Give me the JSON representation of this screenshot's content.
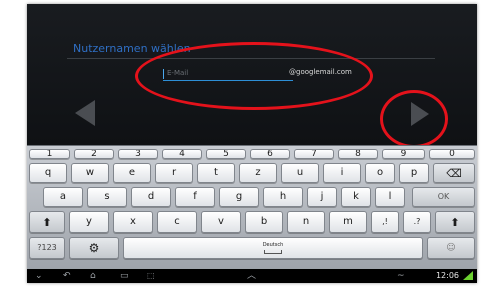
{
  "setup": {
    "title": "Nutzernamen wählen",
    "email_placeholder": "E-Mail",
    "email_domain": "@googlemail.com"
  },
  "keyboard": {
    "numbers": [
      "1",
      "2",
      "3",
      "4",
      "5",
      "6",
      "7",
      "8",
      "9",
      "0"
    ],
    "row1": [
      "q",
      "w",
      "e",
      "r",
      "t",
      "z",
      "u",
      "i",
      "o",
      "p"
    ],
    "row2": [
      "a",
      "s",
      "d",
      "f",
      "g",
      "h",
      "j",
      "k",
      "l"
    ],
    "ok_label": "OK",
    "row3": [
      "y",
      "x",
      "c",
      "v",
      "b",
      "n",
      "m"
    ],
    "punct1": ",!",
    "punct2": ".?",
    "symbols_label": "?123",
    "space_label": "Deutsch"
  },
  "statusbar": {
    "time": "12:06"
  },
  "colors": {
    "title_blue": "#2f6fc4",
    "annotation_red": "#e4121b",
    "signal_green": "#6bd12f"
  },
  "icons": {
    "back_arrow": "back-arrow-icon",
    "next_arrow": "next-arrow-icon",
    "backspace": "backspace-icon",
    "shift": "shift-icon",
    "settings": "gear-icon"
  }
}
